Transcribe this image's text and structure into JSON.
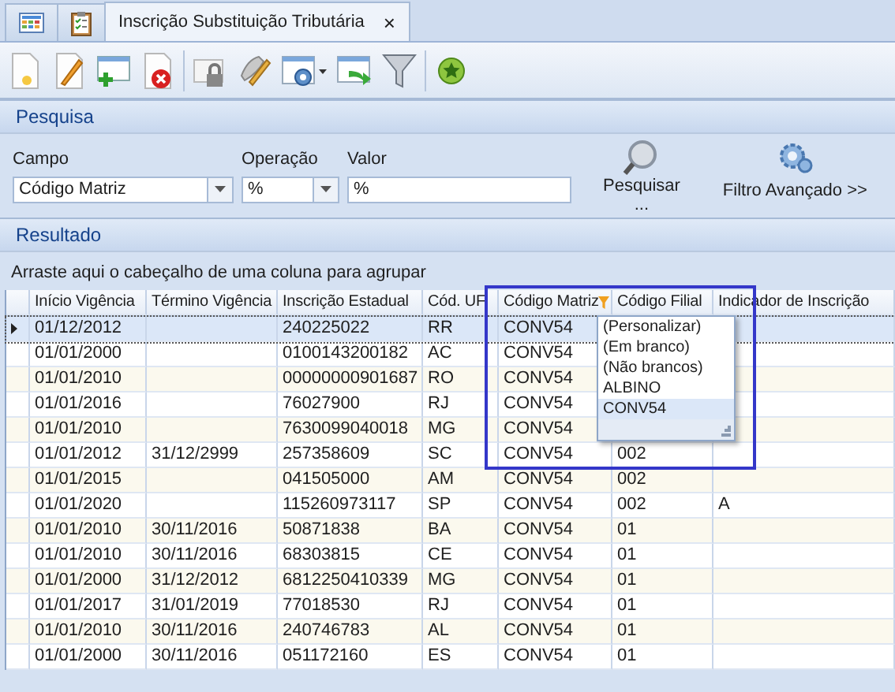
{
  "tabs": [
    {
      "kind": "grid-icon",
      "selected": false
    },
    {
      "kind": "clipboard-icon",
      "selected": false
    },
    {
      "kind": "text",
      "label": "Inscrição Substituição Tributária",
      "close": "×",
      "selected": true
    }
  ],
  "toolbar": [
    {
      "kind": "new"
    },
    {
      "kind": "edit"
    },
    {
      "kind": "add-row"
    },
    {
      "kind": "delete"
    },
    {
      "kind": "separator"
    },
    {
      "kind": "lock"
    },
    {
      "kind": "pencil"
    },
    {
      "kind": "settings-dropdown"
    },
    {
      "kind": "export"
    },
    {
      "kind": "funnel"
    },
    {
      "kind": "separator"
    },
    {
      "kind": "star"
    }
  ],
  "search": {
    "title": "Pesquisa",
    "fields": [
      {
        "kind": "combo",
        "label": "Campo",
        "value": "Código Matriz"
      },
      {
        "kind": "combo",
        "label": "Operação",
        "value": "%"
      },
      {
        "kind": "text",
        "label": "Valor",
        "value": "%"
      }
    ],
    "search_button": {
      "label": "Pesquisar",
      "sublabel": "..."
    },
    "advanced_button": {
      "label": "Filtro Avançado >>"
    }
  },
  "result": {
    "title": "Resultado",
    "group_hint": "Arraste aqui o cabeçalho de uma coluna para agrupar",
    "columns": [
      {
        "label": "Início Vigência",
        "filtered": false
      },
      {
        "label": "Término Vigência",
        "filtered": false
      },
      {
        "label": "Inscrição Estadual",
        "filtered": false
      },
      {
        "label": "Cód. UF",
        "filtered": false
      },
      {
        "label": "Código Matriz",
        "filtered": true
      },
      {
        "label": "Código Filial",
        "filtered": false
      },
      {
        "label": "Indicador de Inscrição",
        "filtered": false
      }
    ],
    "rows": [
      {
        "selected": true,
        "cells": [
          "01/12/2012",
          "",
          "240225022",
          "RR",
          "CONV54",
          null,
          ""
        ]
      },
      {
        "selected": false,
        "cells": [
          "01/01/2000",
          "",
          "0100143200182",
          "AC",
          "CONV54",
          null,
          ""
        ]
      },
      {
        "selected": false,
        "cells": [
          "01/01/2010",
          "",
          "00000000901687",
          "RO",
          "CONV54",
          null,
          ""
        ]
      },
      {
        "selected": false,
        "cells": [
          "01/01/2016",
          "",
          "76027900",
          "RJ",
          "CONV54",
          null,
          ""
        ]
      },
      {
        "selected": false,
        "cells": [
          "01/01/2010",
          "",
          "7630099040018",
          "MG",
          "CONV54",
          null,
          ""
        ]
      },
      {
        "selected": false,
        "cells": [
          "01/01/2012",
          "31/12/2999",
          "257358609",
          "SC",
          "CONV54",
          "002",
          ""
        ]
      },
      {
        "selected": false,
        "cells": [
          "01/01/2015",
          "",
          "041505000",
          "AM",
          "CONV54",
          "002",
          ""
        ]
      },
      {
        "selected": false,
        "cells": [
          "01/01/2020",
          "",
          "115260973117",
          "SP",
          "CONV54",
          "002",
          "A"
        ]
      },
      {
        "selected": false,
        "cells": [
          "01/01/2010",
          "30/11/2016",
          "50871838",
          "BA",
          "CONV54",
          "01",
          ""
        ]
      },
      {
        "selected": false,
        "cells": [
          "01/01/2010",
          "30/11/2016",
          "68303815",
          "CE",
          "CONV54",
          "01",
          ""
        ]
      },
      {
        "selected": false,
        "cells": [
          "01/01/2000",
          "31/12/2012",
          "6812250410339",
          "MG",
          "CONV54",
          "01",
          ""
        ]
      },
      {
        "selected": false,
        "cells": [
          "01/01/2017",
          "31/01/2019",
          "77018530",
          "RJ",
          "CONV54",
          "01",
          ""
        ]
      },
      {
        "selected": false,
        "cells": [
          "01/01/2010",
          "30/11/2016",
          "240746783",
          "AL",
          "CONV54",
          "01",
          ""
        ]
      },
      {
        "selected": false,
        "cells": [
          "01/01/2000",
          "30/11/2016",
          "051172160",
          "ES",
          "CONV54",
          "01",
          ""
        ]
      }
    ],
    "filter_popup": {
      "items": [
        {
          "label": "(Personalizar)",
          "selected": false
        },
        {
          "label": "(Em branco)",
          "selected": false
        },
        {
          "label": "(Não brancos)",
          "selected": false
        },
        {
          "label": "ALBINO",
          "selected": false
        },
        {
          "label": "CONV54",
          "selected": true
        }
      ]
    }
  }
}
